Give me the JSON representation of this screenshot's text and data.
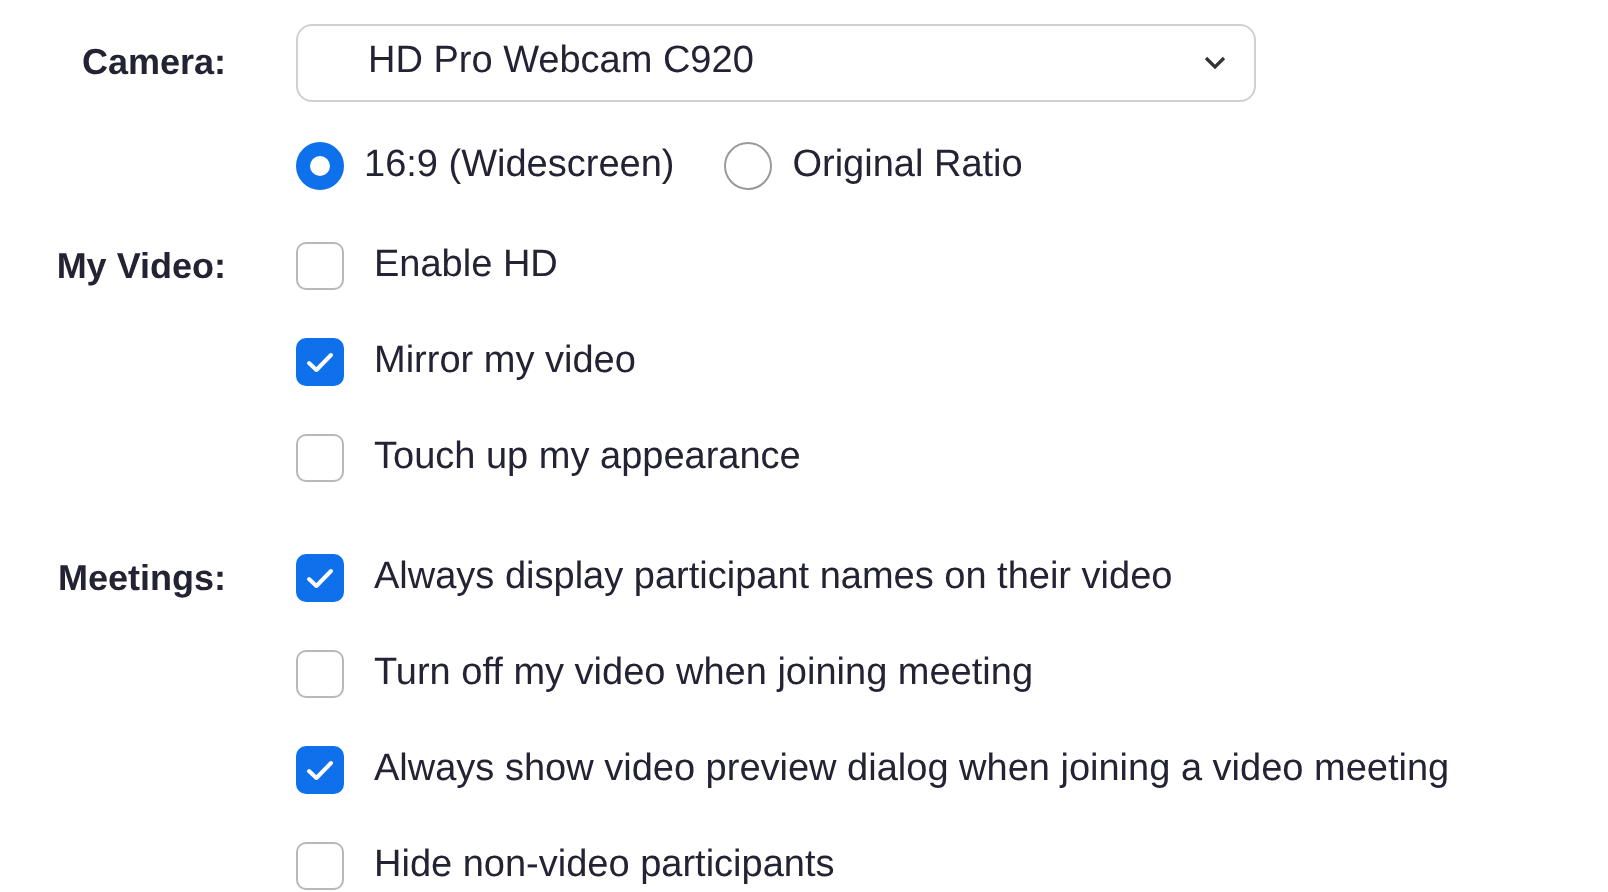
{
  "camera": {
    "label": "Camera:",
    "value": "HD Pro Webcam C920"
  },
  "ratios": [
    {
      "label": "16:9 (Widescreen)",
      "selected": true
    },
    {
      "label": "Original Ratio",
      "selected": false
    }
  ],
  "sections": [
    {
      "label": "My Video:",
      "options": [
        {
          "label": "Enable HD",
          "checked": false
        },
        {
          "label": "Mirror my video",
          "checked": true
        },
        {
          "label": "Touch up my appearance",
          "checked": false
        }
      ]
    },
    {
      "label": "Meetings:",
      "options": [
        {
          "label": "Always display participant names on their video",
          "checked": true
        },
        {
          "label": "Turn off my video when joining meeting",
          "checked": false
        },
        {
          "label": "Always show video preview dialog when joining a video meeting",
          "checked": true
        },
        {
          "label": "Hide non-video participants",
          "checked": false
        }
      ]
    }
  ]
}
